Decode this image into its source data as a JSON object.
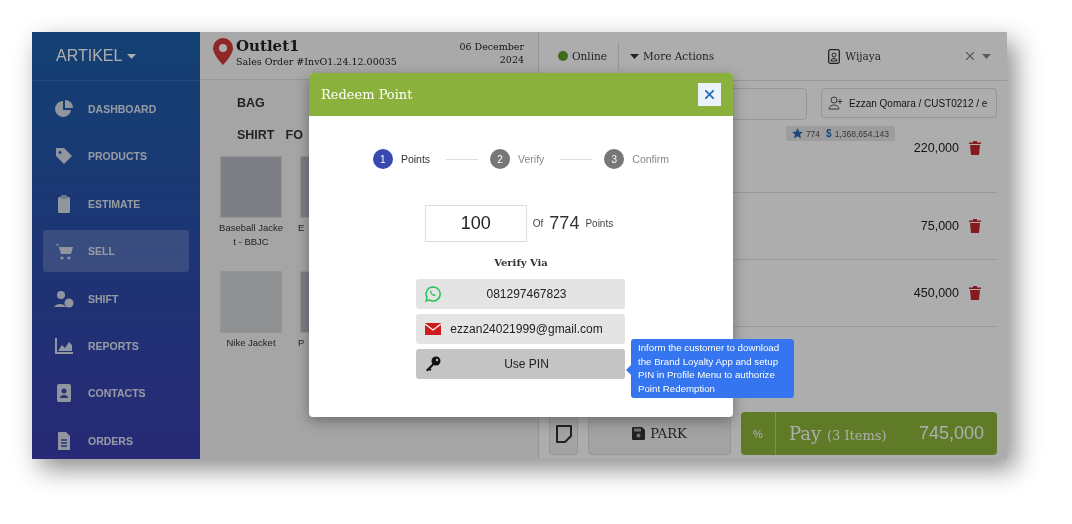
{
  "sidebar": {
    "brand": "ARTIKEL",
    "items": [
      {
        "label": "DASHBOARD",
        "selected": false
      },
      {
        "label": "PRODUCTS",
        "selected": false
      },
      {
        "label": "ESTIMATE",
        "selected": false
      },
      {
        "label": "SELL",
        "selected": true
      },
      {
        "label": "SHIFT",
        "selected": false
      },
      {
        "label": "REPORTS",
        "selected": false
      },
      {
        "label": "CONTACTS",
        "selected": false
      },
      {
        "label": "ORDERS",
        "selected": false
      }
    ]
  },
  "header": {
    "outlet": "Outlet1",
    "order": "Sales Order #InvO1.24.12.00035",
    "date_line_1": "06 December",
    "date_line_2": "2024",
    "status": "Online",
    "online": true,
    "more_actions": "More Actions",
    "user": "Wijaya"
  },
  "categories": [
    {
      "label": "BAG"
    },
    {
      "label": "SHIRT"
    },
    {
      "label": "FO"
    }
  ],
  "products": [
    {
      "name": "Baseball Jacket - BBJC"
    },
    {
      "name": "E"
    },
    {
      "name": "Nike Jacket"
    },
    {
      "name": "P"
    }
  ],
  "customer": {
    "field": "Ezzan Qomara / CUST0212 / e",
    "points": "774",
    "currency": "$",
    "balance": "1,368,654.143"
  },
  "cart": [
    {
      "price": "220,000"
    },
    {
      "price": "75,000"
    },
    {
      "price": "450,000"
    }
  ],
  "footer": {
    "park": "PARK",
    "discount": "%",
    "pay": "Pay",
    "count": "(3 Items)",
    "total": "745,000"
  },
  "modal": {
    "title": "Redeem Point",
    "steps": [
      {
        "number": "1",
        "label": "Points",
        "selected": true
      },
      {
        "number": "2",
        "label": "Verify",
        "selected": false
      },
      {
        "number": "3",
        "label": "Confirm",
        "selected": false
      }
    ],
    "points_value": "100",
    "of": "Of",
    "points_total": "774",
    "points_unit": "Points",
    "verify_heading": "Verify Via",
    "options": [
      {
        "kind": "whatsapp",
        "label": "081297467823",
        "selected": false
      },
      {
        "kind": "email",
        "label": "ezzan24021999@gmail.com",
        "selected": false
      },
      {
        "kind": "pin",
        "label": "Use PIN",
        "selected": true
      }
    ],
    "tooltip": "Inform the customer to download the Brand Loyalty App and setup PIN in Profile Menu to authorize Point Redemption"
  }
}
